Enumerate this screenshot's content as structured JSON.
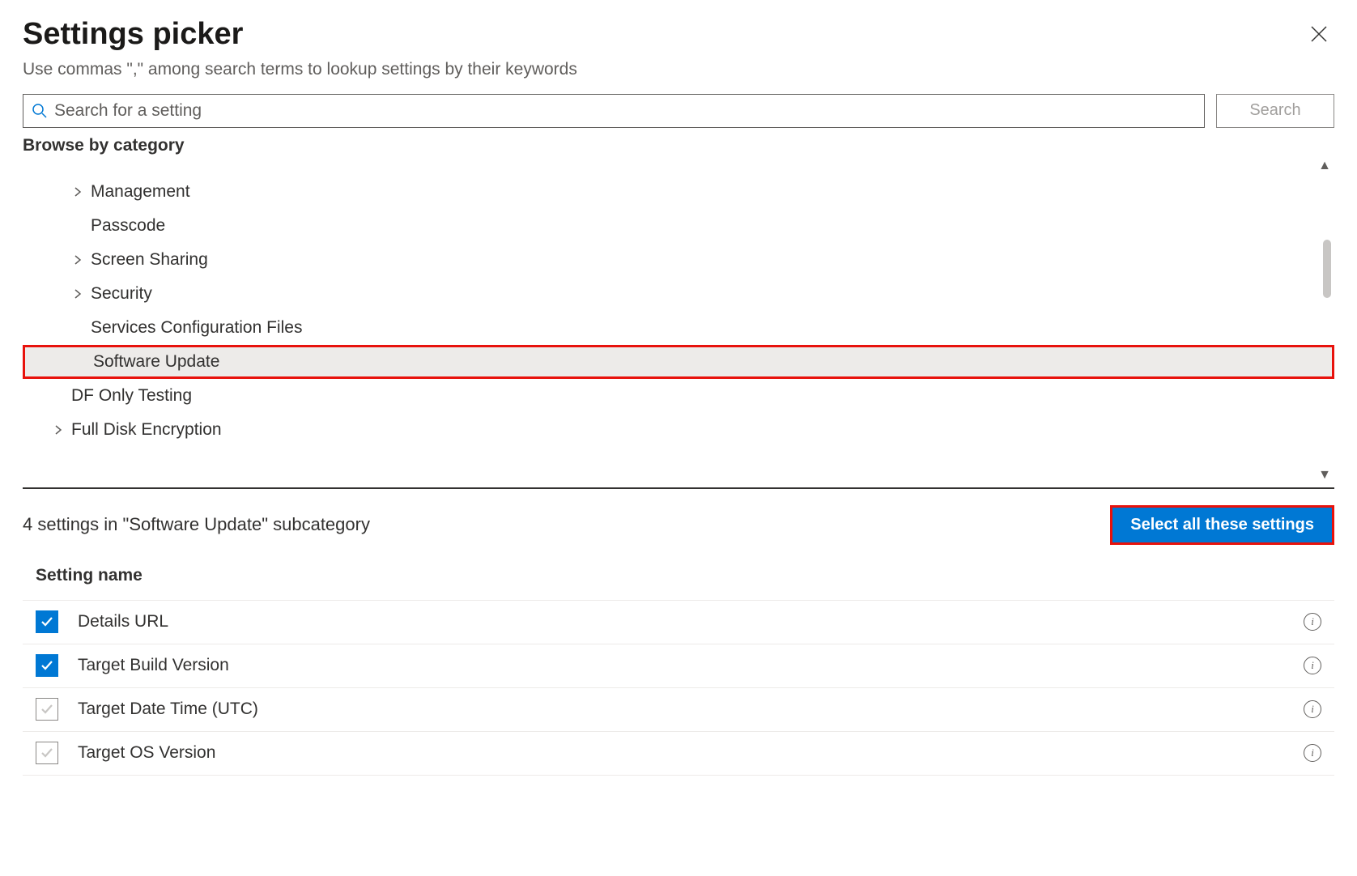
{
  "header": {
    "title": "Settings picker",
    "subtitle": "Use commas \",\" among search terms to lookup settings by their keywords"
  },
  "search": {
    "placeholder": "Search for a setting",
    "button_label": "Search"
  },
  "browse": {
    "label": "Browse by category",
    "categories": [
      {
        "label": "Management",
        "expandable": true,
        "indent": 1,
        "selected": false
      },
      {
        "label": "Passcode",
        "expandable": false,
        "indent": 1,
        "selected": false
      },
      {
        "label": "Screen Sharing",
        "expandable": true,
        "indent": 1,
        "selected": false
      },
      {
        "label": "Security",
        "expandable": true,
        "indent": 1,
        "selected": false
      },
      {
        "label": "Services Configuration Files",
        "expandable": false,
        "indent": 1,
        "selected": false
      },
      {
        "label": "Software Update",
        "expandable": false,
        "indent": 1,
        "selected": true
      },
      {
        "label": "DF Only Testing",
        "expandable": false,
        "indent": 0,
        "selected": false
      },
      {
        "label": "Full Disk Encryption",
        "expandable": true,
        "indent": 0,
        "selected": false
      }
    ]
  },
  "subcategory": {
    "summary": "4 settings in \"Software Update\" subcategory",
    "select_all_label": "Select all these settings",
    "column_header": "Setting name",
    "settings": [
      {
        "name": "Details URL",
        "checked": true
      },
      {
        "name": "Target Build Version",
        "checked": true
      },
      {
        "name": "Target Date Time (UTC)",
        "checked": false
      },
      {
        "name": "Target OS Version",
        "checked": false
      }
    ]
  }
}
